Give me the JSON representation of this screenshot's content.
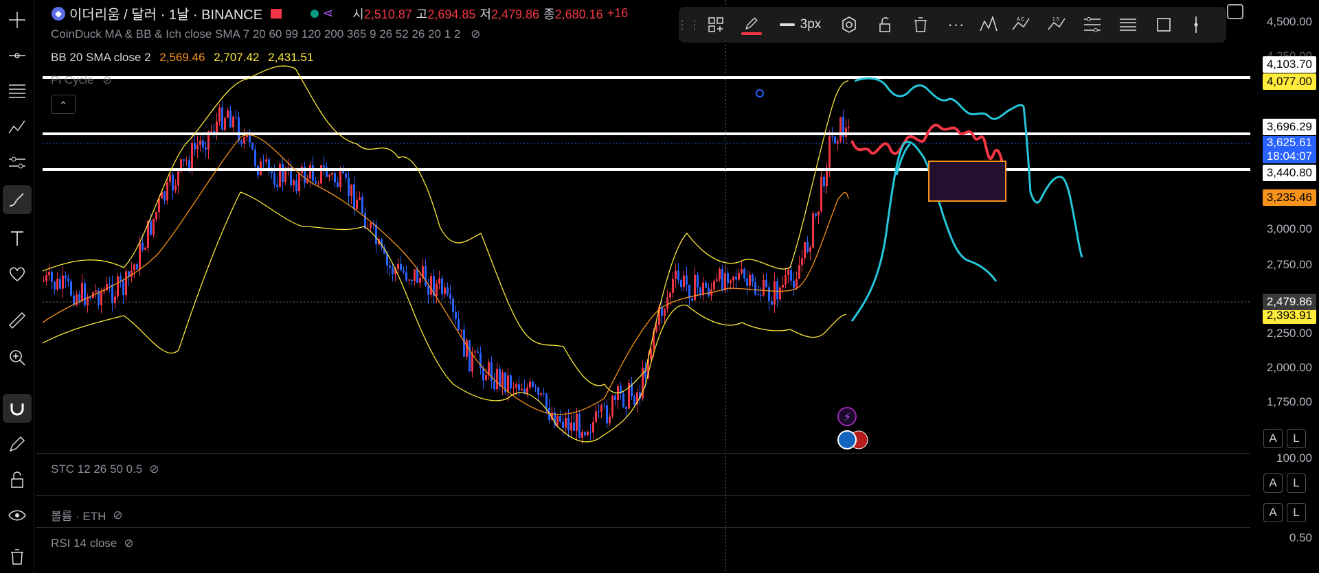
{
  "symbol": {
    "title": "이더리움 / 달러 · 1날 · BINANCE",
    "ohlc": [
      {
        "k": "시",
        "v": "2,510.87"
      },
      {
        "k": "고",
        "v": "2,694.85"
      },
      {
        "k": "저",
        "v": "2,479.86"
      },
      {
        "k": "종",
        "v": "2,680.16"
      }
    ],
    "change": "+16"
  },
  "indicators": {
    "coinduck": "CoinDuck MA & BB & Ich close SMA 7 20 60 99 120 200 365 9 26 52 26 20 1 2",
    "bb_label": "BB 20 SMA close 2",
    "bb_values": [
      "2,569.46",
      "2,707.42",
      "2,431.51"
    ],
    "pi_cycle": "Pi Cycle"
  },
  "drawing_toolbar": {
    "width_label": "3px",
    "icons": [
      "drag-handle-icon",
      "templates-icon",
      "pencil-icon",
      "line-width-icon",
      "settings-icon",
      "lock-icon",
      "delete-icon",
      "more-icon",
      "pattern-icon",
      "abcd-icon",
      "elliott-icon",
      "fib-icon",
      "fib-channel-icon",
      "rectangle-icon",
      "vertical-line-icon"
    ]
  },
  "left_toolbar": {
    "icons": [
      "crosshair-icon",
      "trend-line-icon",
      "fib-retracement-icon",
      "pattern-icon",
      "forecast-icon",
      "brush-icon",
      "text-icon",
      "heart-icon",
      "ruler-icon",
      "zoom-in-icon",
      "magnet-icon",
      "edit-lock-icon",
      "lock-icon",
      "eye-icon",
      "trash-icon"
    ]
  },
  "price_axis": {
    "ticks": [
      "4,500.00",
      "4,250.00",
      "3,000.00",
      "2,750.00",
      "2,250.00",
      "2,000.00",
      "1,750.00"
    ],
    "tags": [
      {
        "text": "4,103.70",
        "bg": "#ffffff",
        "fg": "#000000"
      },
      {
        "text": "4,077.00",
        "bg": "#ffeb3b",
        "fg": "#000000"
      },
      {
        "text": "3,696.29",
        "bg": "#ffffff",
        "fg": "#000000"
      },
      {
        "text": "3,625.61",
        "bg": "#2962ff",
        "fg": "#ffffff"
      },
      {
        "text": "18:04:07",
        "bg": "#2962ff",
        "fg": "#ffffff"
      },
      {
        "text": "3,440.80",
        "bg": "#ffffff",
        "fg": "#000000"
      },
      {
        "text": "3,235.46",
        "bg": "#f7931a",
        "fg": "#000000"
      },
      {
        "text": "2,479.86",
        "bg": "#3a3a3a",
        "fg": "#ffffff"
      },
      {
        "text": "2,393.91",
        "bg": "#ffeb3b",
        "fg": "#000000"
      }
    ]
  },
  "panes": [
    {
      "label": "STC 12 26 50 0.5",
      "axis": "100.00"
    },
    {
      "label": "볼륨 · ETH",
      "axis": ""
    },
    {
      "label": "RSI 14 close",
      "axis": "0.50"
    }
  ],
  "al_buttons": {
    "a": "A",
    "l": "L"
  },
  "colors": {
    "up": "#f23645",
    "down": "#2962ff",
    "bb": "#ffeb3b",
    "ma": "#f7931a",
    "cyan": "#26c6da"
  }
}
